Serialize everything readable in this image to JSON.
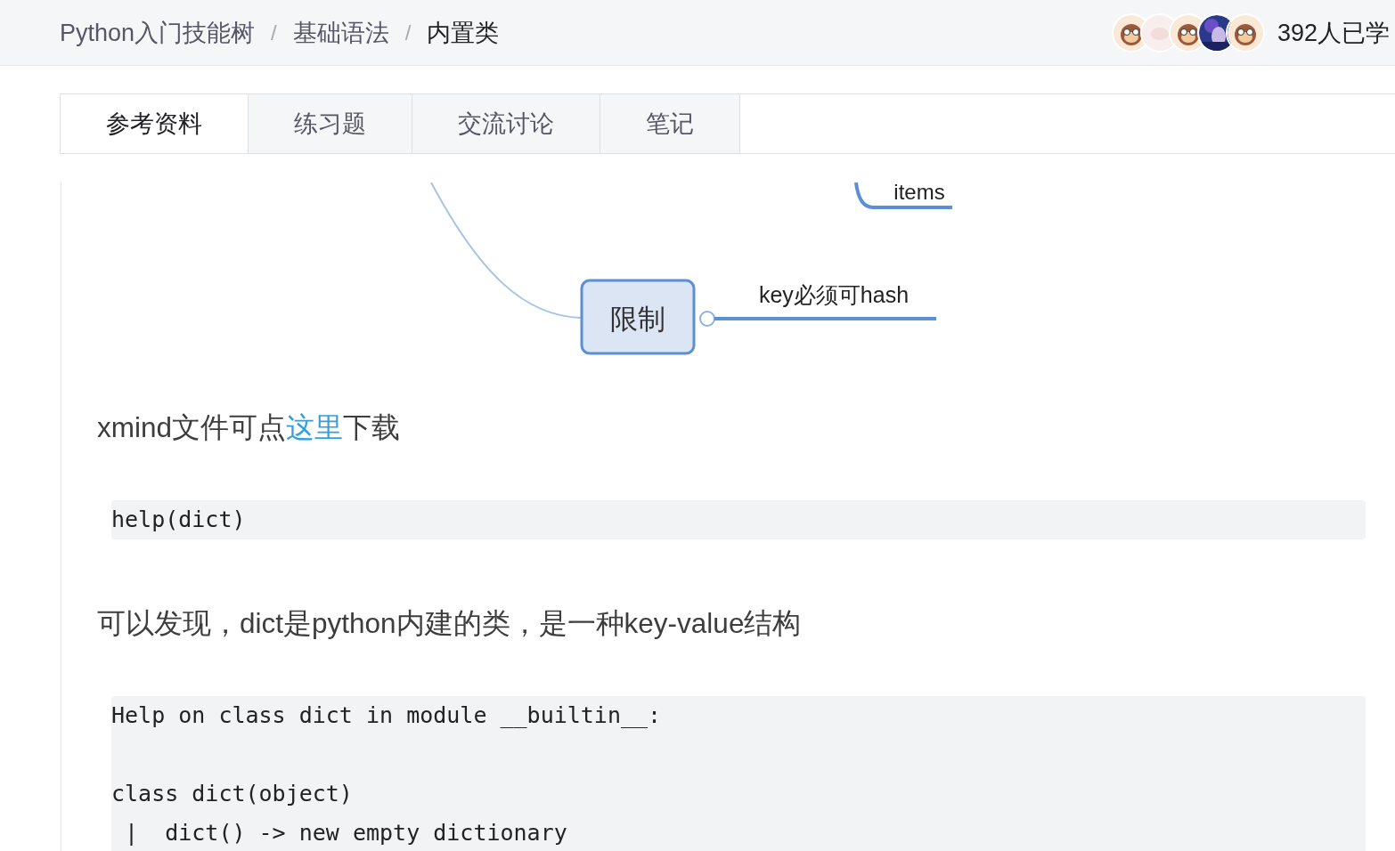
{
  "breadcrumb": [
    {
      "label": "Python入门技能树",
      "separator": "/"
    },
    {
      "label": "基础语法",
      "separator": "/"
    },
    {
      "label": "内置类"
    }
  ],
  "learners": {
    "avatars": [
      {
        "kind": "monkey"
      },
      {
        "kind": "plain"
      },
      {
        "kind": "monkey"
      },
      {
        "kind": "picture"
      },
      {
        "kind": "monkey"
      }
    ],
    "count": "392人已学"
  },
  "tabs": [
    {
      "label": "参考资料",
      "selected": true
    },
    {
      "label": "练习题",
      "selected": false
    },
    {
      "label": "交流讨论",
      "selected": false
    },
    {
      "label": "笔记",
      "selected": false
    }
  ],
  "mindmap": {
    "branch_top": "items",
    "node": "限制",
    "child": "key必须可hash"
  },
  "content": [
    {
      "kind": "text",
      "text": "xmind文件可点",
      "link": "这里",
      "after": "下载"
    },
    {
      "kind": "code",
      "groups": [
        [
          "help(dict)"
        ]
      ]
    },
    {
      "kind": "text",
      "text": "可以发现，dict是python内建的类，是一种key-value结构"
    },
    {
      "kind": "code",
      "groups": [
        [
          "Help on class dict in module __builtin__:"
        ],
        [
          "class dict(object)",
          " |  dict() -> new empty dictionary"
        ]
      ]
    }
  ]
}
